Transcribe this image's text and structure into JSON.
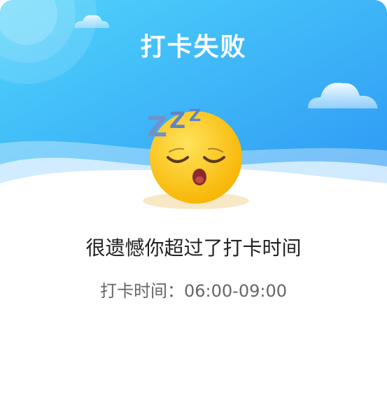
{
  "dialog": {
    "title": "打卡失败",
    "message": "很遗憾你超过了打卡时间",
    "time_label": "打卡时间：",
    "time_range": "06:00-09:00"
  },
  "illustration": {
    "icon": "sleeping-face-emoji",
    "sleep_letters": "ZZZ"
  },
  "colors": {
    "header_top": "#2aa8f5",
    "header_bottom": "#4fd0fb",
    "emoji_yellow": "#ffc600",
    "title_text": "#ffffff",
    "message_text": "#222222",
    "time_text": "#666666"
  }
}
